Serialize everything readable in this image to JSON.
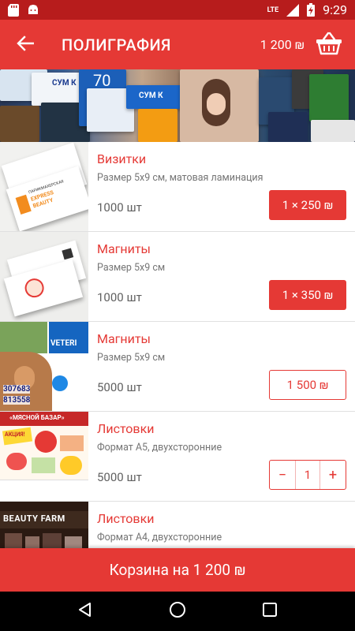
{
  "status_bar": {
    "time": "9:29",
    "network": "LTE",
    "left_icons": [
      "sd-card-icon",
      "android-icon"
    ],
    "right_icons": [
      "signal-icon",
      "battery-charging-icon"
    ]
  },
  "app_bar": {
    "title": "ПОЛИГРАФИЯ",
    "cart_total": "1 200 ₪",
    "back_icon": "arrow-back-icon",
    "cart_icon": "basket-icon"
  },
  "banner": {
    "thumb_texts": [
      "СУМ К",
      "СУМ К",
      "70"
    ]
  },
  "products": [
    {
      "name": "Визитки",
      "description": "Размер 5x9 см, матовая ламинация",
      "quantity": "1000 шт",
      "action": "1 × 250 ₪",
      "action_style": "filled"
    },
    {
      "name": "Магниты",
      "description": "Размер 5x9 см",
      "quantity": "1000 шт",
      "action": "1 × 350 ₪",
      "action_style": "filled"
    },
    {
      "name": "Магниты",
      "description": "Размер 5x9 см",
      "quantity": "5000 шт",
      "action": "1 500 ₪",
      "action_style": "outline"
    },
    {
      "name": "Листовки",
      "description": "Формат А5, двухсторонние",
      "quantity": "5000 шт",
      "action_style": "stepper",
      "stepper": {
        "minus": "−",
        "value": "1",
        "plus": "+"
      }
    },
    {
      "name": "Листовки",
      "description": "Формат А4, двухсторонние",
      "quantity": "",
      "action_style": "none"
    }
  ],
  "thumbnails": {
    "vizitki_lines": [
      "ПАРИКМАХЕРСКАЯ",
      "EXPRESS",
      "BEAUTY"
    ],
    "vet_lines": [
      "VETERI",
      "307683",
      "813558"
    ],
    "bazar_lines": [
      "«МЯСНОЙ БАЗАР»",
      "АКЦИЯ!"
    ],
    "beauty_lines": [
      "BEAUTY FARM"
    ]
  },
  "checkout": {
    "label": "Корзина на 1 200 ₪"
  },
  "nav_bar": {
    "icons": [
      "back-triangle-icon",
      "home-circle-icon",
      "recents-square-icon"
    ]
  },
  "colors": {
    "primary": "#e53935",
    "status_bar": "#b71c1c",
    "text_secondary": "#757575"
  }
}
